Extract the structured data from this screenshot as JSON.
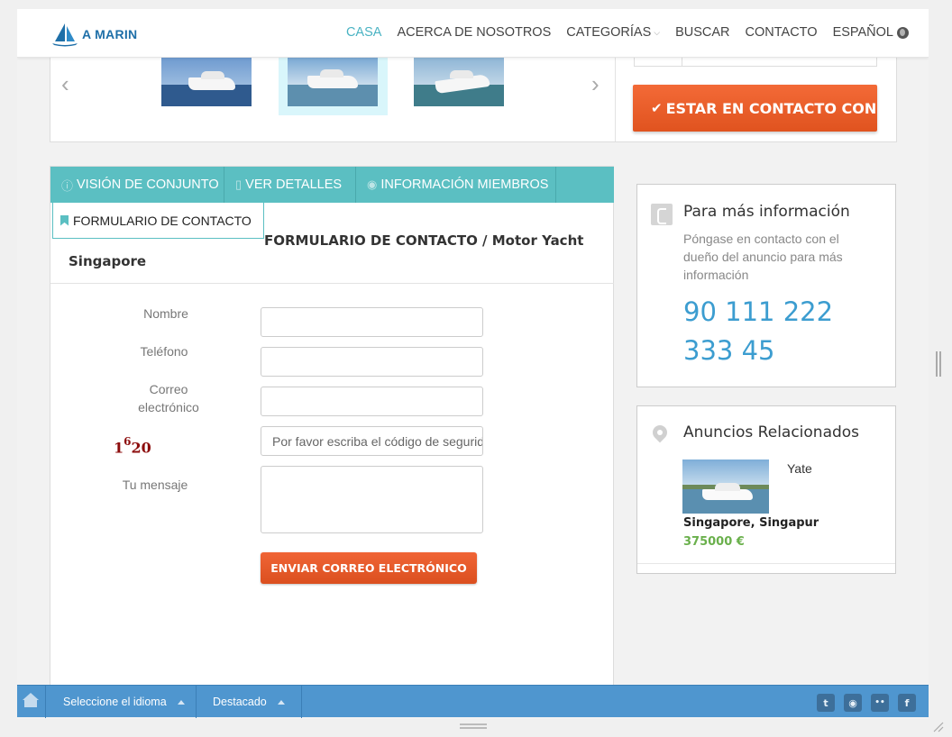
{
  "brand": {
    "name": "A MARIN"
  },
  "nav": {
    "items": [
      {
        "label": "CASA",
        "active": true
      },
      {
        "label": "ACERCA DE NOSOTROS"
      },
      {
        "label": "CATEGORÍAS",
        "dropdown": true
      },
      {
        "label": "BUSCAR"
      },
      {
        "label": "CONTACTO"
      },
      {
        "label": "ESPAÑOL",
        "icon": "globe-icon"
      }
    ]
  },
  "gallery": {
    "prev_icon": "chevron-left-icon",
    "next_icon": "chevron-right-icon"
  },
  "contact_button": {
    "label": "ESTAR EN CONTACTO CON",
    "icon": "check-icon"
  },
  "tabs": [
    {
      "label": "VISIÓN DE CONJUNTO",
      "icon": "info-icon"
    },
    {
      "label": "VER DETALLES",
      "icon": "document-icon"
    },
    {
      "label": "INFORMACIÓN MIEMBROS",
      "icon": "user-icon"
    }
  ],
  "active_tab": {
    "label": "FORMULARIO DE CONTACTO",
    "icon": "bookmark-icon"
  },
  "form": {
    "title_line1": "FORMULARIO DE CONTACTO / Motor Yacht",
    "title_line2": "Singapore",
    "fields": {
      "name_label": "Nombre",
      "phone_label": "Teléfono",
      "email_label_1": "Correo",
      "email_label_2": "electrónico",
      "message_label": "Tu mensaje",
      "captcha_placeholder": "Por favor escriba el código de seguridad"
    },
    "captcha": {
      "d1": "1",
      "d2": "6",
      "d3": "20"
    },
    "submit_label": "ENVIAR CORREO ELECTRÓNICO"
  },
  "info_box": {
    "title": "Para más información",
    "description": "Póngase en contacto con el dueño del anuncio para más información",
    "phone": "90 111 222 333 45",
    "icon": "phone-icon"
  },
  "related": {
    "title": "Anuncios Relacionados",
    "icon": "map-pin-icon",
    "items": [
      {
        "type": "Yate",
        "location": "Singapore, Singapur",
        "price": "375000 €"
      }
    ]
  },
  "bottombar": {
    "language_label": "Seleccione el idioma",
    "featured_label": "Destacado",
    "social": [
      {
        "name": "twitter-icon",
        "glyph": "t"
      },
      {
        "name": "rss-icon",
        "glyph": "◉"
      },
      {
        "name": "flickr-icon",
        "glyph": "••"
      },
      {
        "name": "facebook-icon",
        "glyph": "f"
      }
    ]
  },
  "colors": {
    "accent_teal": "#5bbfc2",
    "cta_orange": "#e9592a",
    "phone_blue": "#3c9dd0",
    "price_green": "#6ab04c",
    "bar_blue": "#4f96cf"
  }
}
